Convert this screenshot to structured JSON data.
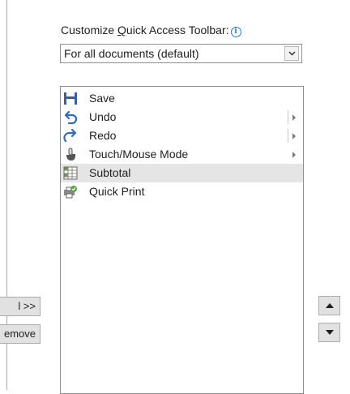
{
  "qat": {
    "label_pre": "Customize ",
    "label_u": "Q",
    "label_post": "uick Access Toolbar:",
    "info_icon": "info-icon",
    "scope_value": "For all documents (default)"
  },
  "commands": [
    {
      "label": "Save",
      "icon": "save-icon",
      "submenu": false,
      "selected": false
    },
    {
      "label": "Undo",
      "icon": "undo-icon",
      "submenu": true,
      "selected": false
    },
    {
      "label": "Redo",
      "icon": "redo-icon",
      "submenu": true,
      "selected": false
    },
    {
      "label": "Touch/Mouse Mode",
      "icon": "touch-mode-icon",
      "submenu": true,
      "selected": false
    },
    {
      "label": "Subtotal",
      "icon": "subtotal-icon",
      "submenu": false,
      "selected": true
    },
    {
      "label": "Quick Print",
      "icon": "quick-print-icon",
      "submenu": false,
      "selected": false
    }
  ],
  "buttons": {
    "add": "l >>",
    "remove": "emove",
    "move_up": "move-up-icon",
    "move_down": "move-down-icon"
  },
  "colors": {
    "save": "#3b5da8",
    "undo": "#2e6bc5",
    "selected_row": "#e5e5e5",
    "button_face": "#e1e1e1"
  }
}
